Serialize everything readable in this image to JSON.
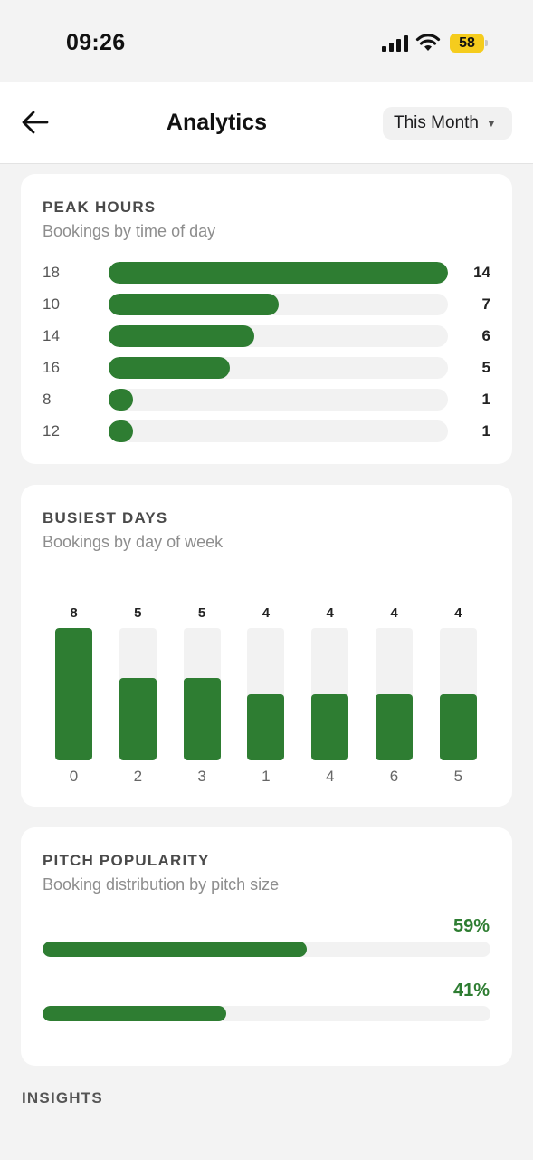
{
  "status_bar": {
    "time": "09:26",
    "battery": "58"
  },
  "header": {
    "title": "Analytics",
    "period_selected": "This Month",
    "back_icon": "arrow-left-icon"
  },
  "peak_hours": {
    "title": "PEAK HOURS",
    "subtitle": "Bookings by time of day",
    "max": 14,
    "rows": [
      {
        "hour": "18",
        "count": 14
      },
      {
        "hour": "10",
        "count": 7
      },
      {
        "hour": "14",
        "count": 6
      },
      {
        "hour": "16",
        "count": 5
      },
      {
        "hour": "8",
        "count": 1
      },
      {
        "hour": "12",
        "count": 1
      }
    ]
  },
  "busiest_days": {
    "title": "BUSIEST DAYS",
    "subtitle": "Bookings by day of week",
    "max": 8,
    "days": [
      {
        "label": "0",
        "count": 8
      },
      {
        "label": "2",
        "count": 5
      },
      {
        "label": "3",
        "count": 5
      },
      {
        "label": "1",
        "count": 4
      },
      {
        "label": "4",
        "count": 4
      },
      {
        "label": "6",
        "count": 4
      },
      {
        "label": "5",
        "count": 4
      }
    ]
  },
  "pitch_popularity": {
    "title": "PITCH POPULARITY",
    "subtitle": "Booking distribution by pitch size",
    "items": [
      {
        "percent_label": "59%",
        "percent": 59
      },
      {
        "percent_label": "41%",
        "percent": 41
      }
    ]
  },
  "insights": {
    "heading": "INSIGHTS"
  },
  "colors": {
    "accent": "#2e7d32",
    "track": "#f2f2f2",
    "battery": "#f5cc1d"
  }
}
